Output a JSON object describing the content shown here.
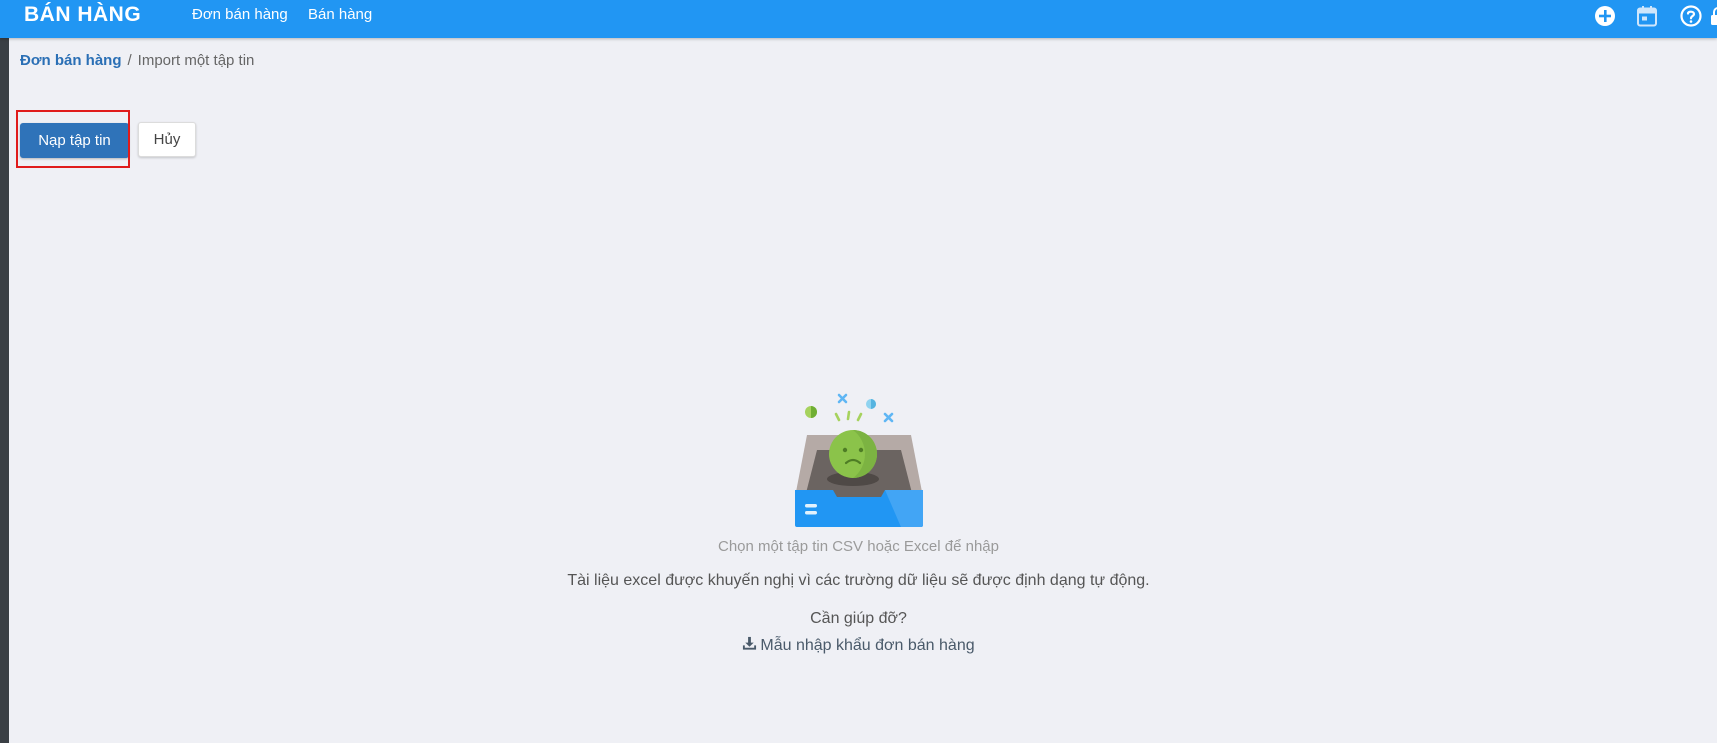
{
  "navbar": {
    "brand": "BÁN HÀNG",
    "menu": [
      "Đơn bán hàng",
      "Bán hàng"
    ],
    "icons": [
      "plus-circle-icon",
      "calendar-icon",
      "help-circle-icon",
      "lock-icon"
    ],
    "color": "#2196f3"
  },
  "breadcrumb": {
    "parent": "Đơn bán hàng",
    "separator": "/",
    "current": "Import một tập tin"
  },
  "toolbar": {
    "upload_label": "Nạp tập tin",
    "cancel_label": "Hủy",
    "primary_color": "#2f73b9",
    "highlight_color": "#e01b1b"
  },
  "empty_state": {
    "illustration": "empty-inbox-sad-face",
    "prompt": "Chọn một tập tin CSV hoặc Excel để nhập",
    "note": "Tài liệu excel được khuyến nghị vì các trường dữ liệu sẽ được định dạng tự động.",
    "help_question": "Cần giúp đỡ?",
    "template_link": "Mẫu nhập khẩu đơn bán hàng",
    "template_icon": "download-icon"
  }
}
